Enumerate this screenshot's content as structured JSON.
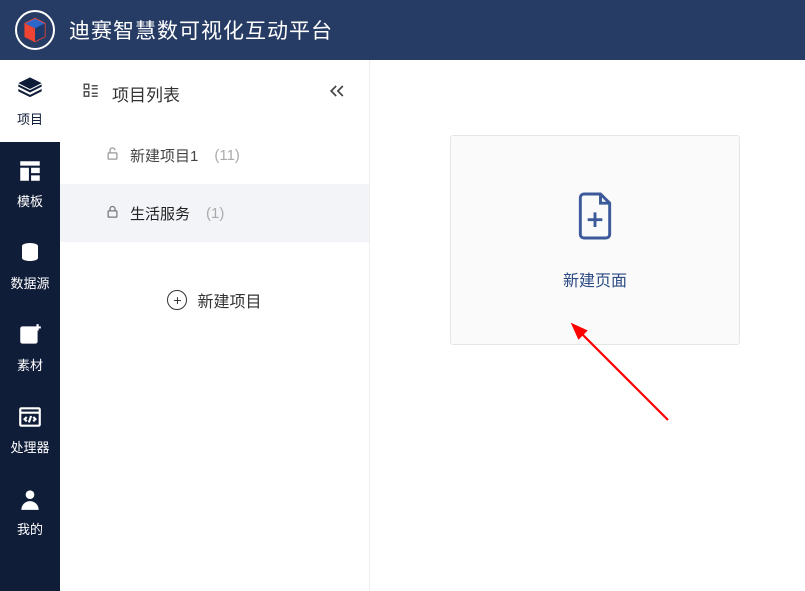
{
  "header": {
    "title": "迪赛智慧数可视化互动平台"
  },
  "sidebar": {
    "items": [
      {
        "label": "项目",
        "icon": "layers-icon",
        "active": true
      },
      {
        "label": "模板",
        "icon": "template-icon",
        "active": false
      },
      {
        "label": "数据源",
        "icon": "database-icon",
        "active": false
      },
      {
        "label": "素材",
        "icon": "image-plus-icon",
        "active": false
      },
      {
        "label": "处理器",
        "icon": "code-window-icon",
        "active": false
      },
      {
        "label": "我的",
        "icon": "person-icon",
        "active": false
      }
    ]
  },
  "projectList": {
    "heading": "项目列表",
    "items": [
      {
        "name": "新建项目1",
        "count": "(11)",
        "icon": "lock-open-icon",
        "active": false
      },
      {
        "name": "生活服务",
        "count": "(1)",
        "icon": "lock-icon",
        "active": true
      }
    ],
    "newProjectLabel": "新建项目"
  },
  "content": {
    "newPageLabel": "新建页面"
  }
}
